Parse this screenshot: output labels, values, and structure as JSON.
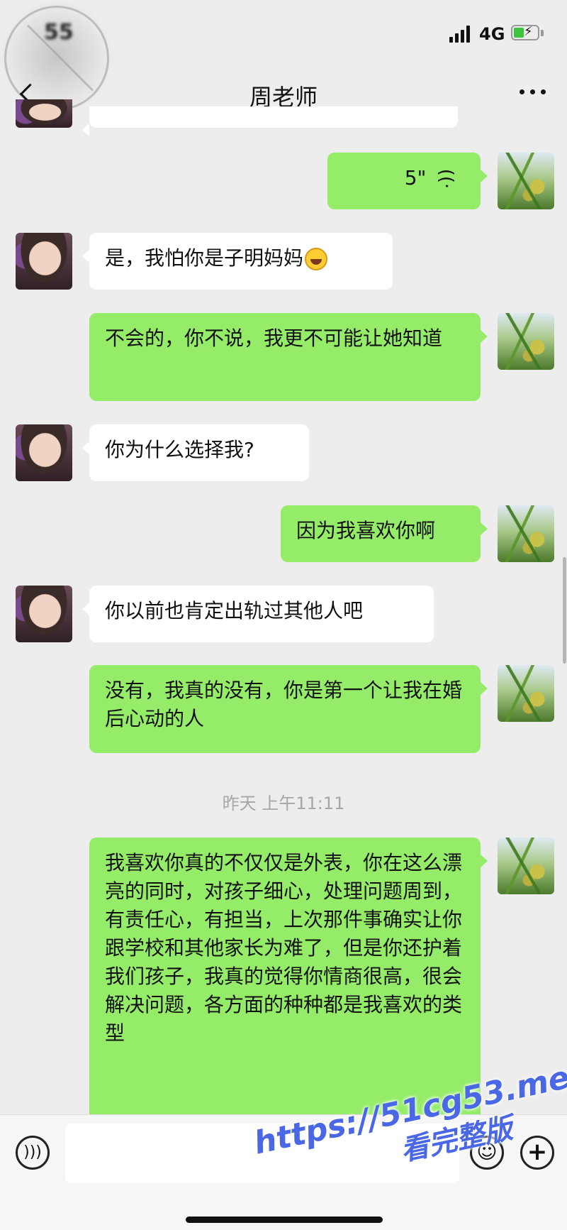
{
  "status_bar": {
    "time": "55",
    "network": "4G"
  },
  "nav": {
    "title": "周老师"
  },
  "messages": [
    {
      "side": "right",
      "type": "voice",
      "duration": "5\""
    },
    {
      "side": "left",
      "text": "是，我怕你是子明妈妈"
    },
    {
      "side": "right",
      "text": "不会的，你不说，我更不可能让她知道"
    },
    {
      "side": "left",
      "text": "你为什么选择我?"
    },
    {
      "side": "right",
      "text": "因为我喜欢你啊"
    },
    {
      "side": "left",
      "text": "你以前也肯定出轨过其他人吧"
    },
    {
      "side": "right",
      "text": "没有，我真的没有，你是第一个让我在婚后心动的人"
    },
    {
      "side": "right",
      "text": "我喜欢你真的不仅仅是外表，你在这么漂亮的同时，对孩子细心，处理问题周到，有责任心，有担当，上次那件事确实让你跟学校和其他家长为难了，但是你还护着我们孩子，我真的觉得你情商很高，很会解决问题，各方面的种种都是我喜欢的类型"
    }
  ],
  "timestamp": "昨天 上午11:11",
  "watermark": {
    "line1": "https://51cg53.me",
    "line2": "看完整版"
  },
  "icons": {
    "back": "chevron-left-icon",
    "more": "more-dots-icon",
    "voice_input": "voice-icon",
    "emoji": "emoji-icon",
    "plus": "plus-icon"
  },
  "colors": {
    "background": "#ededed",
    "outgoing_bubble": "#95ec69",
    "incoming_bubble": "#ffffff",
    "watermark": "#4a68e6"
  }
}
